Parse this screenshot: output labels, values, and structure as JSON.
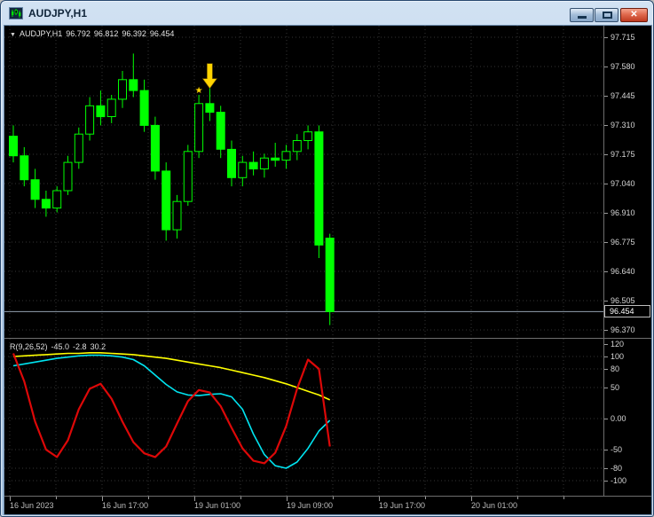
{
  "window": {
    "title": "AUDJPY,H1",
    "controls": {
      "close_glyph": "✕"
    }
  },
  "chart": {
    "header": {
      "dropdown_icon": "▼",
      "symbol_period": "AUDJPY,H1",
      "open": "96.792",
      "high": "96.812",
      "low": "96.392",
      "close": "96.454"
    },
    "current_price": "96.454",
    "price_scale": [
      "97.715",
      "97.580",
      "97.445",
      "97.310",
      "97.175",
      "97.040",
      "96.910",
      "96.775",
      "96.640",
      "96.505",
      "96.370"
    ],
    "time_scale": [
      "16 Jun 2023",
      "16 Jun 17:00",
      "19 Jun 01:00",
      "19 Jun 09:00",
      "19 Jun 17:00",
      "20 Jun 01:00"
    ]
  },
  "indicator": {
    "name": "R(9,26,52)",
    "value_red": "-45.0",
    "value_cyan": "-2.8",
    "value_yellow": "30.2",
    "scale": [
      "120",
      "100",
      "80",
      "50",
      "0.00",
      "-50",
      "-80",
      "-100"
    ],
    "levels": [
      100,
      80,
      50,
      0,
      -50,
      -80,
      -100
    ]
  },
  "chart_data": {
    "type": "candlestick",
    "symbol": "AUDJPY",
    "timeframe": "H1",
    "title": "AUDJPY,H1 price chart with oscillator R(9,26,52)",
    "price_range": [
      96.37,
      97.715
    ],
    "candles": [
      [
        97.26,
        97.31,
        97.14,
        97.17
      ],
      [
        97.17,
        97.21,
        97.03,
        97.06
      ],
      [
        97.06,
        97.11,
        96.93,
        96.97
      ],
      [
        96.97,
        97.01,
        96.89,
        96.93
      ],
      [
        96.93,
        97.03,
        96.91,
        97.01
      ],
      [
        97.01,
        97.17,
        96.99,
        97.14
      ],
      [
        97.14,
        97.3,
        97.11,
        97.27
      ],
      [
        97.27,
        97.44,
        97.24,
        97.4
      ],
      [
        97.4,
        97.47,
        97.31,
        97.35
      ],
      [
        97.35,
        97.45,
        97.32,
        97.43
      ],
      [
        97.43,
        97.56,
        97.39,
        97.52
      ],
      [
        97.52,
        97.64,
        97.44,
        97.47
      ],
      [
        97.47,
        97.52,
        97.28,
        97.31
      ],
      [
        97.31,
        97.35,
        97.06,
        97.1
      ],
      [
        97.1,
        97.14,
        96.78,
        96.83
      ],
      [
        96.83,
        96.99,
        96.79,
        96.96
      ],
      [
        96.96,
        97.22,
        96.94,
        97.19
      ],
      [
        97.19,
        97.45,
        97.16,
        97.41
      ],
      [
        97.41,
        97.5,
        97.33,
        97.37
      ],
      [
        97.37,
        97.4,
        97.16,
        97.2
      ],
      [
        97.2,
        97.24,
        97.03,
        97.07
      ],
      [
        97.07,
        97.17,
        97.03,
        97.14
      ],
      [
        97.14,
        97.19,
        97.08,
        97.11
      ],
      [
        97.11,
        97.18,
        97.07,
        97.16
      ],
      [
        97.16,
        97.23,
        97.12,
        97.15
      ],
      [
        97.15,
        97.22,
        97.11,
        97.19
      ],
      [
        97.19,
        97.27,
        97.15,
        97.24
      ],
      [
        97.24,
        97.31,
        97.2,
        97.28
      ],
      [
        97.28,
        97.31,
        96.7,
        96.76
      ],
      [
        96.792,
        96.812,
        96.392,
        96.454
      ]
    ],
    "indicator_series": [
      {
        "name": "yellow",
        "values": [
          100,
          101,
          102,
          103,
          104,
          105,
          105,
          106,
          106,
          105,
          104,
          103,
          101,
          99,
          97,
          94,
          91,
          88,
          85,
          82,
          78,
          74,
          70,
          66,
          61,
          56,
          50,
          44,
          38,
          30.2
        ]
      },
      {
        "name": "cyan",
        "values": [
          85,
          88,
          91,
          94,
          97,
          99,
          101,
          102,
          102,
          101,
          99,
          95,
          85,
          70,
          55,
          43,
          38,
          37,
          39,
          40,
          35,
          15,
          -25,
          -58,
          -76,
          -80,
          -70,
          -48,
          -20,
          -2.8
        ]
      },
      {
        "name": "red",
        "values": [
          105,
          60,
          -5,
          -50,
          -62,
          -35,
          15,
          48,
          56,
          32,
          -5,
          -38,
          -56,
          -62,
          -45,
          -8,
          28,
          46,
          42,
          20,
          -15,
          -48,
          -68,
          -72,
          -55,
          -12,
          48,
          95,
          80,
          -45
        ]
      }
    ],
    "annotations": {
      "arrow": {
        "bar": 18,
        "price": 97.48
      },
      "star": {
        "bar": 17,
        "price": 97.47,
        "glyph": "★"
      }
    }
  },
  "colors": {
    "background": "#000000",
    "grid": "#343434",
    "candle": "#00ff00",
    "bull_fill": "#000000",
    "red_line": "#dd0808",
    "cyan_line": "#00e4f0",
    "yellow_line": "#ffff00",
    "price_line": "#93a1af",
    "arrow": "#ffd400",
    "titlebar": "#b3cce6",
    "close_button": "#bf3a20"
  }
}
